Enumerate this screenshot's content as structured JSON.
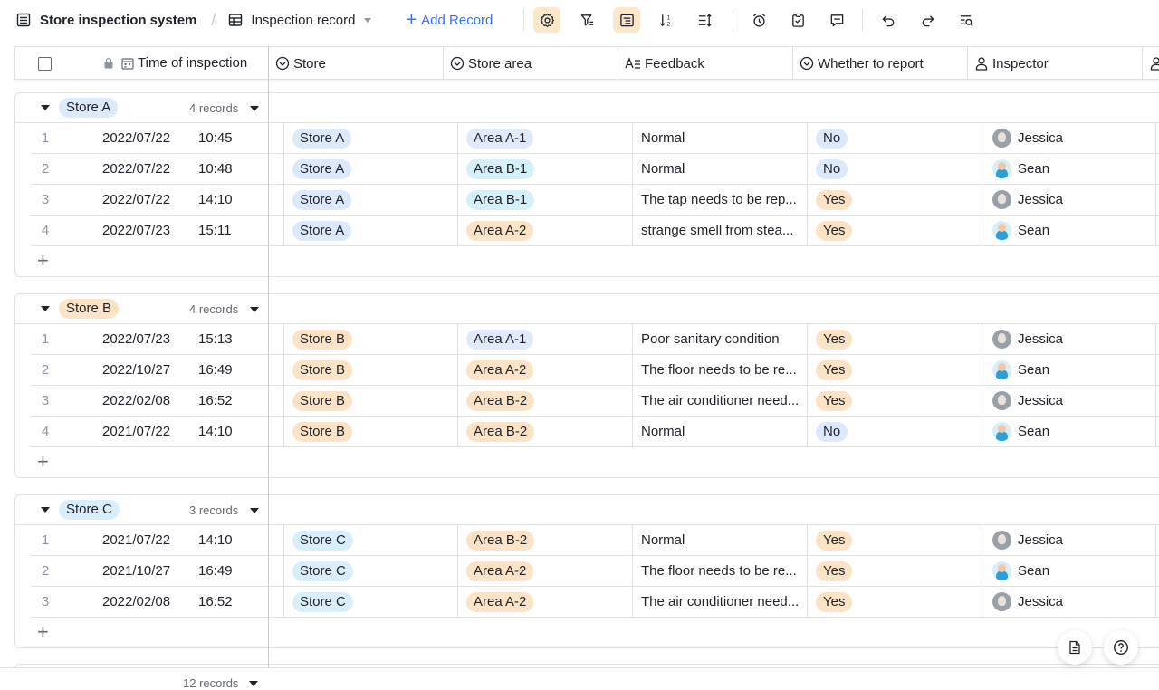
{
  "toolbar": {
    "app_title": "Store inspection system",
    "separator": "/",
    "view_name": "Inspection record",
    "add_record": "Add Record",
    "add_plus": "+",
    "accent": "#3370ff",
    "active_bg": "#fde7c9",
    "icons": [
      "table-icon",
      "grid-view-icon",
      "settings-icon",
      "filter-icon",
      "group-icon",
      "sort-icon",
      "row-height-icon",
      "alarm-icon",
      "form-icon",
      "comment-icon",
      "undo-icon",
      "redo-icon",
      "search-icon"
    ]
  },
  "columns": {
    "time": "Time of inspection",
    "store": "Store",
    "area": "Store area",
    "feedback": "Feedback",
    "report": "Whether to report",
    "inspector": "Inspector"
  },
  "colors": {
    "store_a": "#dce8fb",
    "store_b": "#fde3c6",
    "store_c": "#d9eefc",
    "area_a1": "#e1eafc",
    "area_b1": "#d3f0fb",
    "area_a2": "#fde3c6",
    "area_b2": "#fde3c6",
    "yes": "#fde3c6",
    "no": "#dce8fb"
  },
  "groups": [
    {
      "label": "Store A",
      "count": "4 records",
      "add": "+",
      "rows": [
        {
          "idx": "1",
          "date": "2022/07/22",
          "time": "10:45",
          "store": "Store A",
          "area": "Area A-1",
          "feedback": "Normal",
          "report": "No",
          "inspector": "Jessica"
        },
        {
          "idx": "2",
          "date": "2022/07/22",
          "time": "10:48",
          "store": "Store A",
          "area": "Area B-1",
          "feedback": "Normal",
          "report": "No",
          "inspector": "Sean"
        },
        {
          "idx": "3",
          "date": "2022/07/22",
          "time": "14:10",
          "store": "Store A",
          "area": "Area B-1",
          "feedback": "The tap needs to be rep...",
          "report": "Yes",
          "inspector": "Jessica"
        },
        {
          "idx": "4",
          "date": "2022/07/23",
          "time": "15:11",
          "store": "Store A",
          "area": "Area A-2",
          "feedback": "strange smell from stea...",
          "report": "Yes",
          "inspector": "Sean"
        }
      ]
    },
    {
      "label": "Store B",
      "count": "4 records",
      "add": "+",
      "rows": [
        {
          "idx": "1",
          "date": "2022/07/23",
          "time": "15:13",
          "store": "Store B",
          "area": "Area A-1",
          "feedback": "Poor sanitary condition",
          "report": "Yes",
          "inspector": "Jessica"
        },
        {
          "idx": "2",
          "date": "2022/10/27",
          "time": "16:49",
          "store": "Store B",
          "area": "Area A-2",
          "feedback": "The floor needs to be re...",
          "report": "Yes",
          "inspector": "Sean"
        },
        {
          "idx": "3",
          "date": "2022/02/08",
          "time": "16:52",
          "store": "Store B",
          "area": "Area B-2",
          "feedback": "The air conditioner need...",
          "report": "Yes",
          "inspector": "Jessica"
        },
        {
          "idx": "4",
          "date": "2021/07/22",
          "time": "14:10",
          "store": "Store B",
          "area": "Area B-2",
          "feedback": "Normal",
          "report": "No",
          "inspector": "Sean"
        }
      ]
    },
    {
      "label": "Store C",
      "count": "3 records",
      "add": "+",
      "rows": [
        {
          "idx": "1",
          "date": "2021/07/22",
          "time": "14:10",
          "store": "Store C",
          "area": "Area B-2",
          "feedback": "Normal",
          "report": "Yes",
          "inspector": "Jessica"
        },
        {
          "idx": "2",
          "date": "2021/10/27",
          "time": "16:49",
          "store": "Store C",
          "area": "Area A-2",
          "feedback": "The floor needs to be re...",
          "report": "Yes",
          "inspector": "Sean"
        },
        {
          "idx": "3",
          "date": "2022/02/08",
          "time": "16:52",
          "store": "Store C",
          "area": "Area A-2",
          "feedback": "The air conditioner need...",
          "report": "Yes",
          "inspector": "Jessica"
        }
      ]
    }
  ],
  "footer": {
    "total": "12 records"
  }
}
